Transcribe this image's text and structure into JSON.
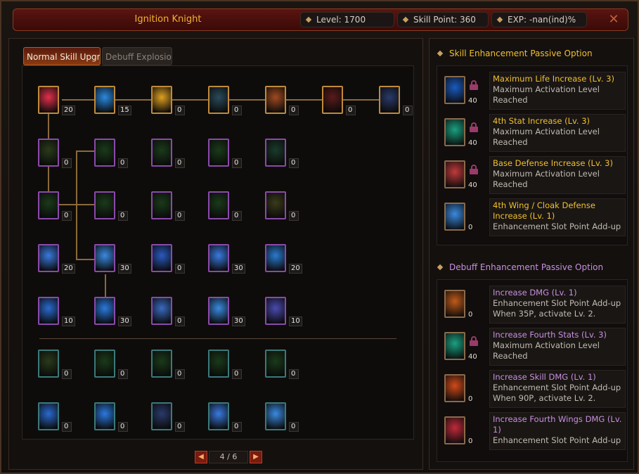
{
  "header": {
    "title": "Ignition Knight",
    "level": "Level: 1700",
    "skill_point": "Skill Point: 360",
    "exp": "EXP: -nan(ind)%",
    "close_icon": "close-icon"
  },
  "tabs": [
    {
      "label": "Normal Skill Upgr",
      "active": true
    },
    {
      "label": "Debuff Explosion",
      "active": false
    }
  ],
  "skill_grid": {
    "rows": [
      {
        "counts": [
          "20",
          "15",
          "0",
          "0",
          "0",
          "0",
          "0"
        ],
        "colors": [
          "#e0304a",
          "#2a8ae0",
          "#e0a020",
          "#2a4a5a",
          "#a04a20",
          "#5a1a1a",
          "#2a3a6a"
        ],
        "borders": [
          "#c08a3a",
          "#c08a3a",
          "#c08a3a",
          "#c08a3a",
          "#c08a3a",
          "#c08a3a",
          "#c08a3a"
        ]
      },
      {
        "counts": [
          "0",
          "0",
          "0",
          "0",
          "0"
        ],
        "colors": [
          "#2a3a1a",
          "#1a3a1a",
          "#1a3a1a",
          "#1a3a1a",
          "#1a3a2a"
        ],
        "borders": [
          "#8a4aaa",
          "#8a4aaa",
          "#8a4aaa",
          "#8a4aaa",
          "#8a4aaa"
        ]
      },
      {
        "counts": [
          "0",
          "0",
          "0",
          "0",
          "0"
        ],
        "colors": [
          "#1a3a1a",
          "#1a3a1a",
          "#1a3a1a",
          "#1a3a1a",
          "#3a3a1a"
        ],
        "borders": [
          "#8a4aaa",
          "#8a4aaa",
          "#8a4aaa",
          "#8a4aaa",
          "#8a4aaa"
        ]
      },
      {
        "counts": [
          "20",
          "30",
          "0",
          "30",
          "20"
        ],
        "colors": [
          "#3a7ae0",
          "#3a8ae0",
          "#2a5ac0",
          "#3a7ae0",
          "#2a7ad0"
        ],
        "borders": [
          "#8a4aaa",
          "#8a4aaa",
          "#8a4aaa",
          "#8a4aaa",
          "#8a4aaa"
        ]
      },
      {
        "counts": [
          "10",
          "30",
          "0",
          "30",
          "10"
        ],
        "colors": [
          "#2a6ad0",
          "#2a7ae0",
          "#3a6ac0",
          "#3a8ae0",
          "#4a4ab0"
        ],
        "borders": [
          "#8a4aaa",
          "#8a4aaa",
          "#8a4aaa",
          "#8a4aaa",
          "#8a4aaa"
        ]
      },
      {
        "counts": [
          "0",
          "0",
          "0",
          "0",
          "0"
        ],
        "colors": [
          "#2a3a1a",
          "#1a3a1a",
          "#1a3a1a",
          "#1a3a1a",
          "#1a3a1a"
        ],
        "borders": [
          "#3a7a7a",
          "#3a7a7a",
          "#3a7a7a",
          "#3a7a7a",
          "#3a7a7a"
        ]
      },
      {
        "counts": [
          "0",
          "0",
          "0",
          "0",
          "0"
        ],
        "colors": [
          "#2a6ad0",
          "#2a7ae0",
          "#2a3a6a",
          "#3a7ae0",
          "#3a8ae0"
        ],
        "borders": [
          "#3a7a7a",
          "#3a7a7a",
          "#3a7a7a",
          "#3a7a7a",
          "#3a7a7a"
        ]
      }
    ]
  },
  "pager": {
    "text": "4 / 6",
    "prev_icon": "arrow-left-icon",
    "next_icon": "arrow-right-icon"
  },
  "skill_enhancement": {
    "heading": "Skill Enhancement Passive Option",
    "items": [
      {
        "title": "Maximum Life Increase (Lv. 3)",
        "desc": "Maximum Activation Level Reached",
        "count": "40",
        "locked": true,
        "color": "#1a5ac0"
      },
      {
        "title": "4th Stat Increase (Lv. 3)",
        "desc": "Maximum Activation Level Reached",
        "count": "40",
        "locked": true,
        "color": "#1aa080"
      },
      {
        "title": "Base Defense Increase (Lv. 3)",
        "desc": "Maximum Activation Level Reached",
        "count": "40",
        "locked": true,
        "color": "#c03a3a"
      },
      {
        "title": "4th Wing / Cloak Defense Increase (Lv. 1)",
        "desc": "Enhancement Slot Point Add-up",
        "count": "0",
        "locked": false,
        "color": "#3a8ae0"
      }
    ]
  },
  "debuff_enhancement": {
    "heading": "Debuff Enhancement Passive Option",
    "items": [
      {
        "title": "Increase DMG (Lv. 1)",
        "desc": "Enhancement Slot Point Add-up When 35P, activate Lv. 2.",
        "count": "0",
        "locked": false,
        "color": "#c05a1a"
      },
      {
        "title": "Increase Fourth Stats (Lv. 3)",
        "desc": "Maximum Activation Level Reached",
        "count": "40",
        "locked": true,
        "color": "#1aa080"
      },
      {
        "title": "Increase Skill DMG (Lv. 1)",
        "desc": "Enhancement Slot Point Add-up When 90P, activate Lv. 2.",
        "count": "0",
        "locked": false,
        "color": "#d04a1a"
      },
      {
        "title": "Increase Fourth Wings DMG (Lv. 1)",
        "desc": "Enhancement Slot Point Add-up",
        "count": "0",
        "locked": false,
        "color": "#c02a3a"
      }
    ]
  }
}
